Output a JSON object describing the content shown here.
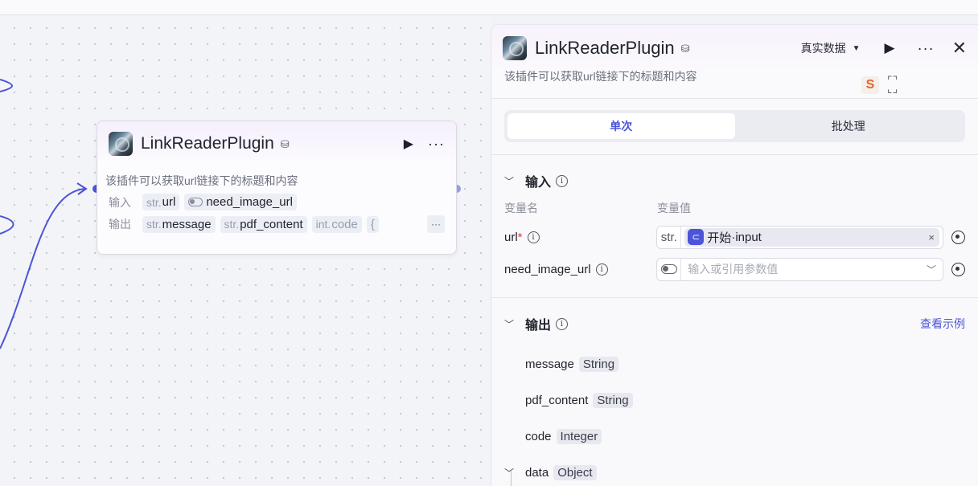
{
  "node": {
    "title": "LinkReaderPlugin",
    "description": "该插件可以获取url链接下的标题和内容",
    "input_label": "输入",
    "output_label": "输出",
    "inputs": [
      {
        "type": "str.",
        "name": "url"
      },
      {
        "type": "toggle",
        "name": "need_image_url"
      }
    ],
    "outputs": [
      {
        "type": "str.",
        "name": "message"
      },
      {
        "type": "str.",
        "name": "pdf_content"
      },
      {
        "type": "int.",
        "name": "code"
      },
      {
        "type": "",
        "name": "{"
      }
    ],
    "more_label": "···"
  },
  "panel": {
    "title": "LinkReaderPlugin",
    "description": "该插件可以获取url链接下的标题和内容",
    "data_mode": "真实数据",
    "badge": "S",
    "tabs": [
      {
        "label": "单次",
        "active": true
      },
      {
        "label": "批处理",
        "active": false
      }
    ],
    "input_section": {
      "title": "输入",
      "col_name": "变量名",
      "col_value": "变量值",
      "params": [
        {
          "name": "url",
          "required": true,
          "type": "str.",
          "ref_source": "开始",
          "ref_sep": " · ",
          "ref_var": "input"
        },
        {
          "name": "need_image_url",
          "required": false,
          "placeholder": "输入或引用参数值"
        }
      ]
    },
    "output_section": {
      "title": "输出",
      "example_link": "查看示例",
      "fields": [
        {
          "name": "message",
          "type": "String"
        },
        {
          "name": "pdf_content",
          "type": "String"
        },
        {
          "name": "code",
          "type": "Integer"
        },
        {
          "name": "data",
          "type": "Object",
          "expanded": true
        }
      ]
    }
  },
  "colors": {
    "accent": "#4c54d8",
    "required": "#e0344b",
    "edge": "#4c54d8"
  }
}
